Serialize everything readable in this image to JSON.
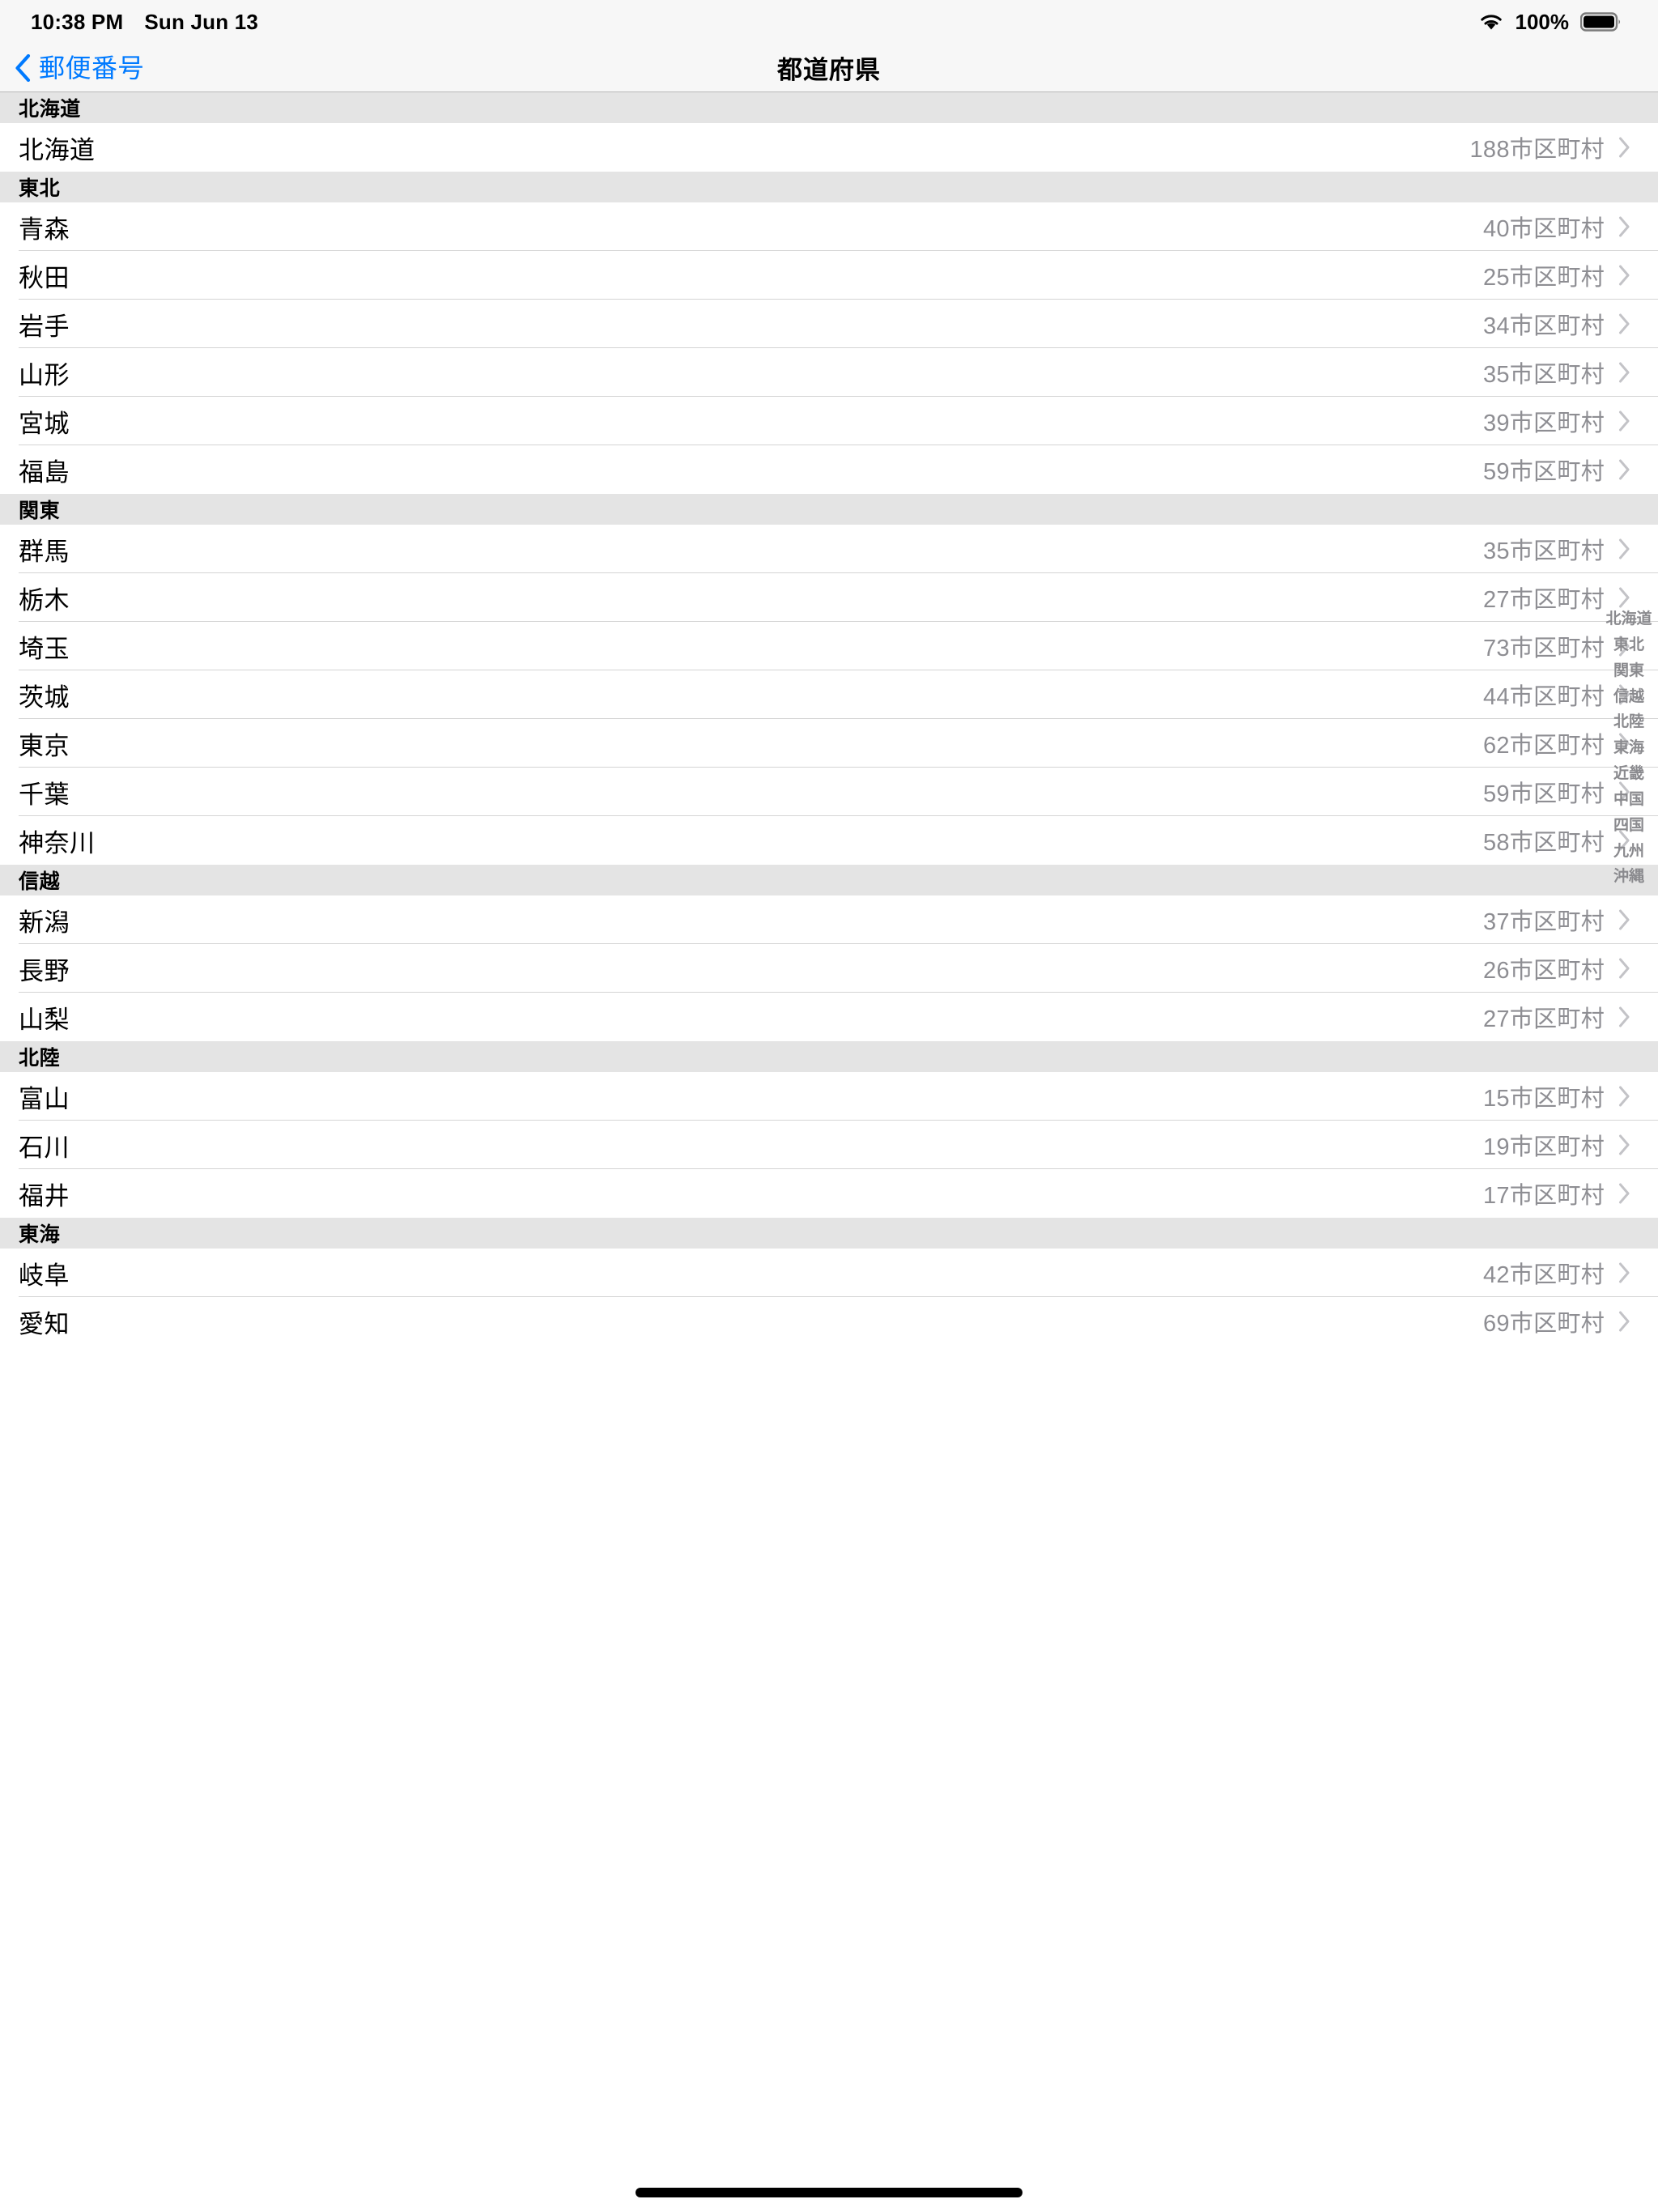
{
  "status_bar": {
    "time": "10:38 PM",
    "date": "Sun Jun 13",
    "battery_percent": "100%",
    "wifi_icon": "wifi-icon",
    "battery_icon": "battery-full-icon"
  },
  "nav_bar": {
    "back_label": "郵便番号",
    "back_icon": "chevron-left-icon",
    "title": "都道府県"
  },
  "colors": {
    "accent": "#007aff",
    "section_header_bg": "#e4e4e4",
    "detail_text": "#8e8e93",
    "separator": "#d4d4d4",
    "chrome_bg": "#f7f7f7"
  },
  "unit_suffix": "市区町村",
  "sections": [
    {
      "title": "北海道",
      "rows": [
        {
          "name": "北海道",
          "detail": "188市区町村"
        }
      ]
    },
    {
      "title": "東北",
      "rows": [
        {
          "name": "青森",
          "detail": "40市区町村"
        },
        {
          "name": "秋田",
          "detail": "25市区町村"
        },
        {
          "name": "岩手",
          "detail": "34市区町村"
        },
        {
          "name": "山形",
          "detail": "35市区町村"
        },
        {
          "name": "宮城",
          "detail": "39市区町村"
        },
        {
          "name": "福島",
          "detail": "59市区町村"
        }
      ]
    },
    {
      "title": "関東",
      "rows": [
        {
          "name": "群馬",
          "detail": "35市区町村"
        },
        {
          "name": "栃木",
          "detail": "27市区町村"
        },
        {
          "name": "埼玉",
          "detail": "73市区町村"
        },
        {
          "name": "茨城",
          "detail": "44市区町村"
        },
        {
          "name": "東京",
          "detail": "62市区町村"
        },
        {
          "name": "千葉",
          "detail": "59市区町村"
        },
        {
          "name": "神奈川",
          "detail": "58市区町村"
        }
      ]
    },
    {
      "title": "信越",
      "rows": [
        {
          "name": "新潟",
          "detail": "37市区町村"
        },
        {
          "name": "長野",
          "detail": "26市区町村"
        },
        {
          "name": "山梨",
          "detail": "27市区町村"
        }
      ]
    },
    {
      "title": "北陸",
      "rows": [
        {
          "name": "富山",
          "detail": "15市区町村"
        },
        {
          "name": "石川",
          "detail": "19市区町村"
        },
        {
          "name": "福井",
          "detail": "17市区町村"
        }
      ]
    },
    {
      "title": "東海",
      "rows": [
        {
          "name": "岐阜",
          "detail": "42市区町村"
        },
        {
          "name": "愛知",
          "detail": "69市区町村"
        }
      ]
    }
  ],
  "section_index": [
    "北海道",
    "東北",
    "関東",
    "信越",
    "北陸",
    "東海",
    "近畿",
    "中国",
    "四国",
    "九州",
    "沖縄"
  ]
}
